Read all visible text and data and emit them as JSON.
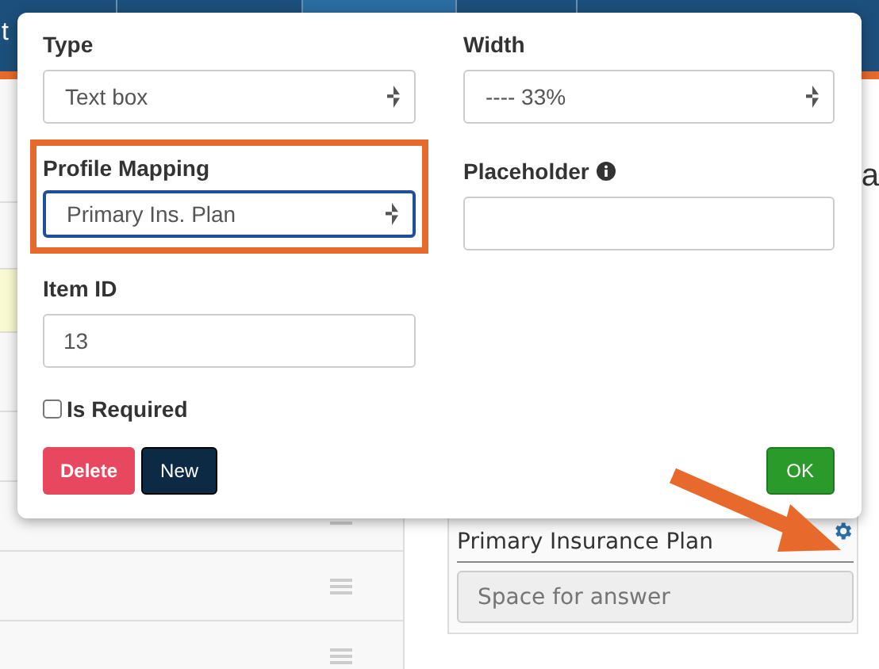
{
  "nav": {
    "tabs": [
      {
        "label": "t",
        "selected": false
      },
      {
        "selected": false
      },
      {
        "selected": true
      },
      {
        "selected": false
      },
      {
        "selected": false
      }
    ]
  },
  "list": {
    "rows": [
      {
        "kind": "draggable"
      },
      {
        "kind": "draggable"
      },
      {
        "kind": "draggable"
      }
    ]
  },
  "heading": "a",
  "popup": {
    "type": {
      "label": "Type",
      "value": "Text box"
    },
    "width": {
      "label": "Width",
      "value": "---- 33%"
    },
    "profile_mapping": {
      "label": "Profile Mapping",
      "value": "Primary Ins. Plan",
      "focused": true
    },
    "placeholder": {
      "label": "Placeholder"
    },
    "item_id": {
      "label": "Item ID",
      "value": "13"
    },
    "is_required": {
      "label": "Is Required",
      "checked": false
    },
    "buttons": [
      {
        "label": "Delete",
        "kind": "danger"
      },
      {
        "label": "New",
        "kind": "dark"
      },
      {
        "label": "OK",
        "kind": "success"
      }
    ]
  },
  "question_card": {
    "title": "Primary Insurance Plan",
    "answer_placeholder": "Space for answer"
  }
}
